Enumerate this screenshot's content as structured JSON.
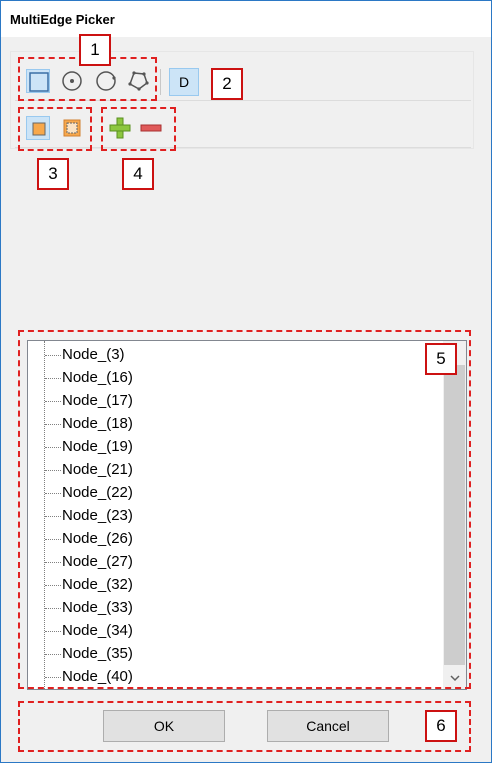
{
  "window": {
    "title": "MultiEdge Picker"
  },
  "toolbar1": {
    "items": [
      {
        "icon": "rectangle-select-icon",
        "selected": true
      },
      {
        "icon": "circle-center-select-icon",
        "selected": false
      },
      {
        "icon": "circle-select-icon",
        "selected": false
      },
      {
        "icon": "polygon-select-icon",
        "selected": false
      }
    ],
    "d_button": {
      "label": "D",
      "selected": true
    }
  },
  "toolbar2": {
    "mode_items": [
      {
        "icon": "fill-square-icon",
        "selected": true
      },
      {
        "icon": "outline-square-icon",
        "selected": false
      }
    ],
    "add_icon": "plus-icon",
    "remove_icon": "minus-icon"
  },
  "tree": {
    "items": [
      "Node_(3)",
      "Node_(16)",
      "Node_(17)",
      "Node_(18)",
      "Node_(19)",
      "Node_(21)",
      "Node_(22)",
      "Node_(23)",
      "Node_(26)",
      "Node_(27)",
      "Node_(32)",
      "Node_(33)",
      "Node_(34)",
      "Node_(35)",
      "Node_(40)"
    ]
  },
  "buttons": {
    "ok": "OK",
    "cancel": "Cancel"
  },
  "callouts": [
    "1",
    "2",
    "3",
    "4",
    "5",
    "6"
  ],
  "colors": {
    "annotation_red": "#e02020",
    "selection_blue": "#cce4f7",
    "orange_fill": "#f7a84c",
    "add_green": "#8cc63f",
    "remove_red": "#e05a5a"
  }
}
